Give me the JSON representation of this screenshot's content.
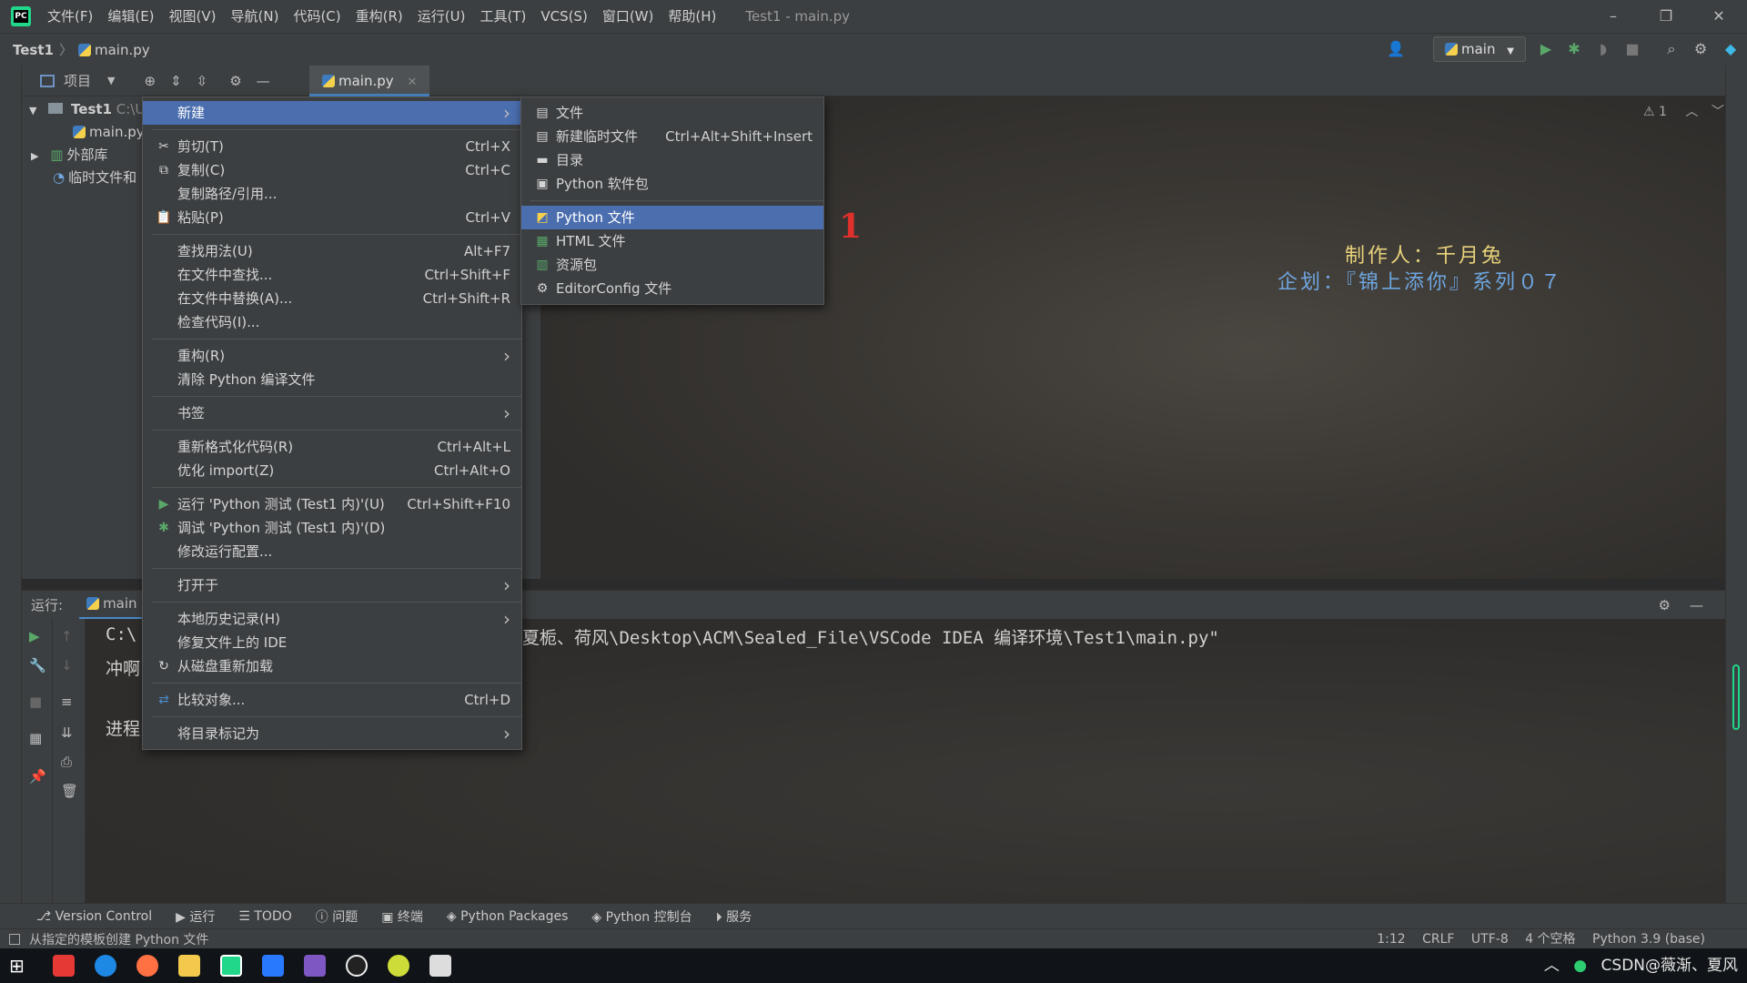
{
  "window": {
    "title": "Test1 - main.py",
    "menu": [
      "文件(F)",
      "编辑(E)",
      "视图(V)",
      "导航(N)",
      "代码(C)",
      "重构(R)",
      "运行(U)",
      "工具(T)",
      "VCS(S)",
      "窗口(W)",
      "帮助(H)"
    ]
  },
  "navbar": {
    "project": "Test1",
    "file": "main.py",
    "run_config": "main"
  },
  "project_panel": {
    "title": "项目",
    "tree": [
      {
        "label": "Test1",
        "suffix": "C:\\U"
      },
      {
        "label": "main.py"
      },
      {
        "label": "外部库"
      },
      {
        "label": "临时文件和"
      }
    ]
  },
  "editor": {
    "tab": "main.py",
    "warning_count": "1",
    "credit_line1": "制作人：千月兔",
    "credit_line2": "企划：『锦上添你』系列０７",
    "marker": "1"
  },
  "context_menu": {
    "groups": [
      [
        {
          "label": "新建",
          "submenu": true,
          "selected": true
        }
      ],
      [
        {
          "label": "剪切(T)",
          "shortcut": "Ctrl+X",
          "icon": "scissors-icon"
        },
        {
          "label": "复制(C)",
          "shortcut": "Ctrl+C",
          "icon": "copy-icon"
        },
        {
          "label": "复制路径/引用..."
        },
        {
          "label": "粘贴(P)",
          "shortcut": "Ctrl+V",
          "icon": "paste-icon"
        }
      ],
      [
        {
          "label": "查找用法(U)",
          "shortcut": "Alt+F7"
        },
        {
          "label": "在文件中查找...",
          "shortcut": "Ctrl+Shift+F"
        },
        {
          "label": "在文件中替换(A)...",
          "shortcut": "Ctrl+Shift+R"
        },
        {
          "label": "检查代码(I)..."
        }
      ],
      [
        {
          "label": "重构(R)",
          "submenu": true
        },
        {
          "label": "清除 Python 编译文件"
        }
      ],
      [
        {
          "label": "书签",
          "submenu": true
        }
      ],
      [
        {
          "label": "重新格式化代码(R)",
          "shortcut": "Ctrl+Alt+L"
        },
        {
          "label": "优化 import(Z)",
          "shortcut": "Ctrl+Alt+O"
        }
      ],
      [
        {
          "label": "运行 'Python 测试 (Test1 内)'(U)",
          "shortcut": "Ctrl+Shift+F10",
          "icon": "run-icon"
        },
        {
          "label": "调试 'Python 测试 (Test1 内)'(D)",
          "icon": "debug-icon"
        },
        {
          "label": "修改运行配置..."
        }
      ],
      [
        {
          "label": "打开于",
          "submenu": true
        }
      ],
      [
        {
          "label": "本地历史记录(H)",
          "submenu": true
        },
        {
          "label": "修复文件上的 IDE"
        },
        {
          "label": "从磁盘重新加载",
          "icon": "reload-icon"
        }
      ],
      [
        {
          "label": "比较对象...",
          "shortcut": "Ctrl+D",
          "icon": "compare-icon"
        }
      ],
      [
        {
          "label": "将目录标记为",
          "submenu": true
        }
      ]
    ]
  },
  "submenu": {
    "groups": [
      [
        {
          "label": "文件",
          "icon": "file-icon"
        },
        {
          "label": "新建临时文件",
          "shortcut": "Ctrl+Alt+Shift+Insert",
          "icon": "scratch-file-icon"
        },
        {
          "label": "目录",
          "icon": "folder-icon"
        },
        {
          "label": "Python 软件包",
          "icon": "package-icon"
        }
      ],
      [
        {
          "label": "Python 文件",
          "selected": true,
          "icon": "python-file-icon"
        },
        {
          "label": "HTML 文件",
          "icon": "html-file-icon"
        },
        {
          "label": "资源包",
          "icon": "resource-bundle-icon"
        },
        {
          "label": "EditorConfig 文件",
          "icon": "gear-icon"
        }
      ]
    ]
  },
  "run_panel": {
    "label": "运行:",
    "tab": "main",
    "console_lines": [
      "C:\\",
      "夏栀、荷风\\Desktop\\ACM\\Sealed_File\\VSCode IDEA 编译环境\\Test1\\main.py\"",
      "冲啊",
      "进程"
    ]
  },
  "bottom_tools": [
    "Version Control",
    "运行",
    "TODO",
    "问题",
    "终端",
    "Python Packages",
    "Python 控制台",
    "服务"
  ],
  "statusbar": {
    "message": "从指定的模板创建 Python 文件",
    "position": "1:12",
    "line_sep": "CRLF",
    "encoding": "UTF-8",
    "indent": "4 个空格",
    "interpreter": "Python 3.9 (base)"
  },
  "taskbar": {
    "tray_text": "CSDN@薇渐、夏风"
  },
  "colors": {
    "selection": "#4b6eaf",
    "background": "#3c3f41",
    "accent_green": "#499c54"
  }
}
